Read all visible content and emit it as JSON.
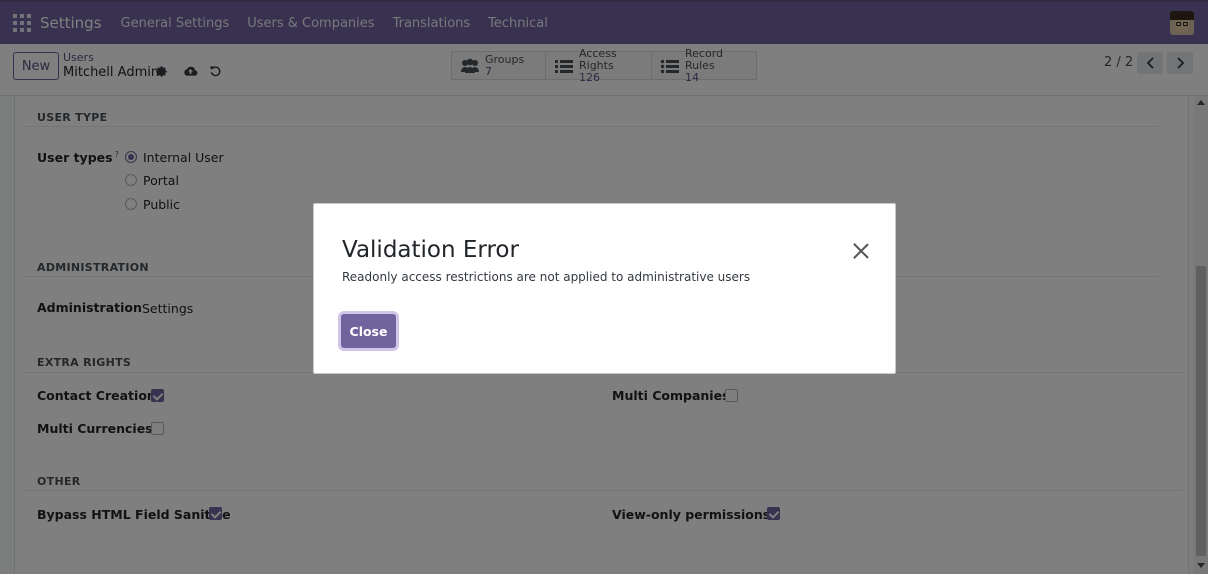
{
  "navbar": {
    "brand": "Settings",
    "menus": [
      "General Settings",
      "Users & Companies",
      "Translations",
      "Technical"
    ],
    "accent_color": "#71639e"
  },
  "control_panel": {
    "new_label": "New",
    "breadcrumb_parent": "Users",
    "breadcrumb_current": "Mitchell Admin",
    "icons": [
      "gear-icon",
      "cloud-upload-icon",
      "undo-icon"
    ],
    "smart_buttons": [
      {
        "label": "Groups",
        "count": "7",
        "icon": "users-icon"
      },
      {
        "label": "Access Rights",
        "count": "126",
        "icon": "list-icon"
      },
      {
        "label": "Record Rules",
        "count": "14",
        "icon": "list-icon"
      }
    ],
    "pager": "2 / 2"
  },
  "form": {
    "user_type": {
      "section": "USER TYPE",
      "label": "User types",
      "help": "?",
      "options": [
        {
          "label": "Internal User",
          "selected": true
        },
        {
          "label": "Portal",
          "selected": false
        },
        {
          "label": "Public",
          "selected": false
        }
      ]
    },
    "administration": {
      "section": "ADMINISTRATION",
      "label": "Administration",
      "value": "Settings"
    },
    "extra_rights": {
      "section": "EXTRA RIGHTS",
      "fields": [
        {
          "label": "Contact Creation",
          "checked": true
        },
        {
          "label": "Multi Companies",
          "checked": false
        },
        {
          "label": "Multi Currencies",
          "checked": false
        }
      ]
    },
    "other": {
      "section": "OTHER",
      "fields": [
        {
          "label": "Bypass HTML Field Sanitize",
          "checked": true
        },
        {
          "label": "View-only permissions",
          "checked": true,
          "help": "?"
        }
      ]
    }
  },
  "dialog": {
    "title": "Validation Error",
    "message": "Readonly access restrictions are not applied to administrative users",
    "close_button": "Close"
  }
}
